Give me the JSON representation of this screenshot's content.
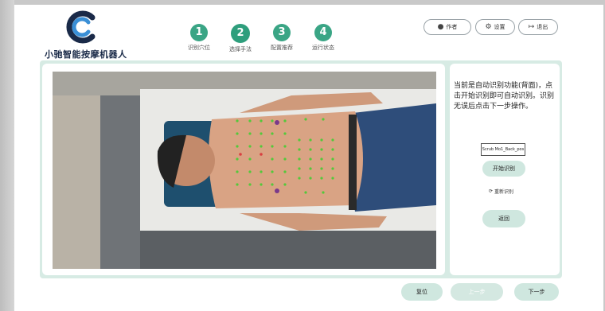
{
  "app": {
    "logo_text": "小驰智能按摩机器人"
  },
  "steps": [
    {
      "num": "1",
      "label": "识别穴位"
    },
    {
      "num": "2",
      "label": "选择手法"
    },
    {
      "num": "3",
      "label": "配置推荐"
    },
    {
      "num": "4",
      "label": "运行状态"
    }
  ],
  "header": {
    "user_label": "作者",
    "settings_label": "设置",
    "logout_label": "退出"
  },
  "sidebar": {
    "info_text": "当前是自动识别功能(背面)，点击开始识别即可自动识别。识别无误后点击下一步操作。",
    "select_value": "Scrub Mo1_Back_pos",
    "start_button": "开始识别",
    "reselect_label": "重新识别",
    "back_button": "返回"
  },
  "footer": {
    "reset_button": "复位",
    "prev_button": "上一步",
    "next_button": "下一步"
  },
  "colors": {
    "accent": "#3aa585",
    "panel_bg": "#d7ebe4",
    "button_bg": "#cfe7df"
  }
}
